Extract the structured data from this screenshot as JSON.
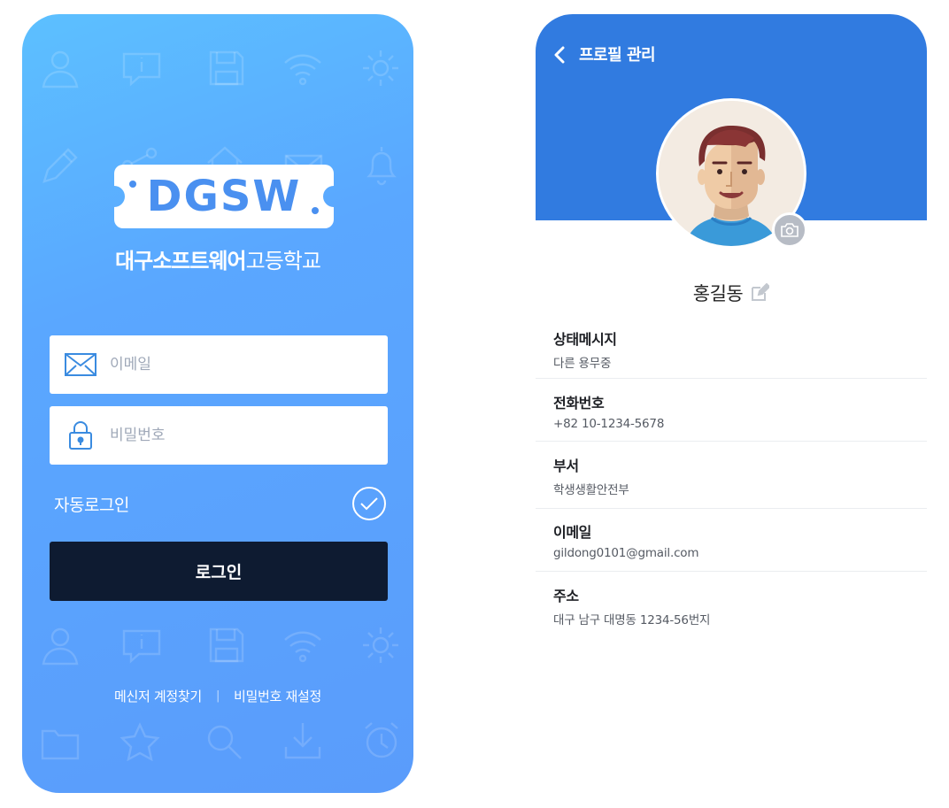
{
  "login": {
    "logo_text": "DGSW",
    "school_name_bold": "대구소프트웨어",
    "school_name_regular": "고등학교",
    "email_placeholder": "이메일",
    "password_placeholder": "비밀번호",
    "auto_login_label": "자동로그인",
    "auto_login_checked": true,
    "login_button": "로그인",
    "find_account_link": "메신저 계정찾기",
    "link_separator": "|",
    "reset_password_link": "비밀번호 재설정",
    "colors": {
      "gradient_start": "#5cc0ff",
      "gradient_end": "#5a9cfb",
      "button": "#0e1b31",
      "logo_text": "#4a90f0"
    }
  },
  "profile": {
    "header_title": "프로필 관리",
    "name": "홍길동",
    "colors": {
      "header": "#317be0",
      "camera_button": "#b7bcc5"
    },
    "fields": [
      {
        "label": "상태메시지",
        "value": "다른 용무중"
      },
      {
        "label": "전화번호",
        "value": "+82 10-1234-5678"
      },
      {
        "label": "부서",
        "value": "학생생활안전부"
      },
      {
        "label": "이메일",
        "value": "gildong0101@gmail.com"
      },
      {
        "label": "주소",
        "value": "대구 남구 대명동 1234-56번지"
      }
    ]
  }
}
